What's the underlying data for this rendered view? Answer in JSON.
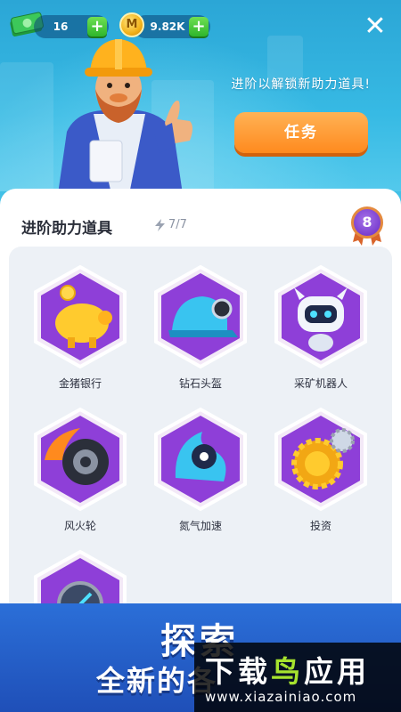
{
  "header": {
    "cash_value": "16",
    "coin_value": "9.82K",
    "coin_symbol": "M",
    "plus_label": "+",
    "close_label": "✕",
    "promo_text": "进阶以解锁新助力道具!",
    "task_button_label": "任务"
  },
  "panel": {
    "title": "进阶助力道具",
    "energy": "7/7",
    "energy_icon": "lightning-icon",
    "level": "8"
  },
  "items": [
    {
      "label": "金猪银行",
      "icon": "piggy-bank-icon"
    },
    {
      "label": "钻石头盔",
      "icon": "mining-helmet-icon"
    },
    {
      "label": "采矿机器人",
      "icon": "mining-robot-icon"
    },
    {
      "label": "风火轮",
      "icon": "flaming-wheel-icon"
    },
    {
      "label": "氮气加速",
      "icon": "nitro-boost-icon"
    },
    {
      "label": "投资",
      "icon": "investment-gears-icon"
    },
    {
      "label": "",
      "icon": "stopwatch-icon"
    }
  ],
  "banner": {
    "title": "探索",
    "subtitle": "全新的各"
  },
  "watermark": {
    "brand_a": "下载",
    "brand_b": "鸟",
    "brand_c": "应用",
    "url": "www.xiazainiao.com"
  },
  "colors": {
    "accent_orange": "#ff8a1e",
    "hex_purple": "#8a3ad6",
    "plus_green": "#2eb52b",
    "panel_bg": "#ffffff"
  }
}
